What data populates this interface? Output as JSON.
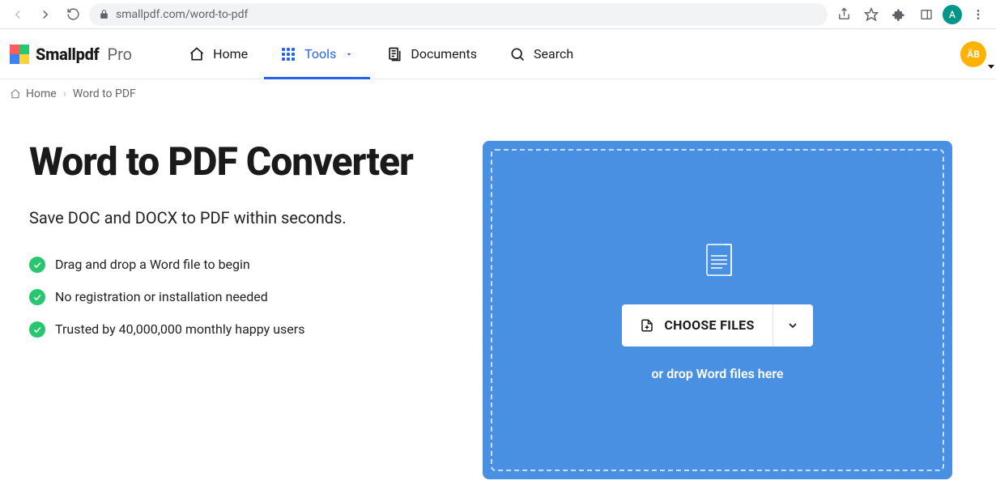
{
  "browser": {
    "url": "smallpdf.com/word-to-pdf",
    "avatar_initial": "A"
  },
  "brand": {
    "name": "Smallpdf",
    "tier": "Pro"
  },
  "nav": {
    "home": "Home",
    "tools": "Tools",
    "documents": "Documents",
    "search": "Search",
    "user_initials": "ÄB"
  },
  "breadcrumb": {
    "home": "Home",
    "current": "Word to PDF"
  },
  "page": {
    "title": "Word to PDF Converter",
    "subtitle": "Save DOC and DOCX to PDF within seconds.",
    "features": [
      "Drag and drop a Word file to begin",
      "No registration or installation needed",
      "Trusted by 40,000,000 monthly happy users"
    ]
  },
  "dropzone": {
    "choose_label": "CHOOSE FILES",
    "hint": "or drop Word files here"
  }
}
